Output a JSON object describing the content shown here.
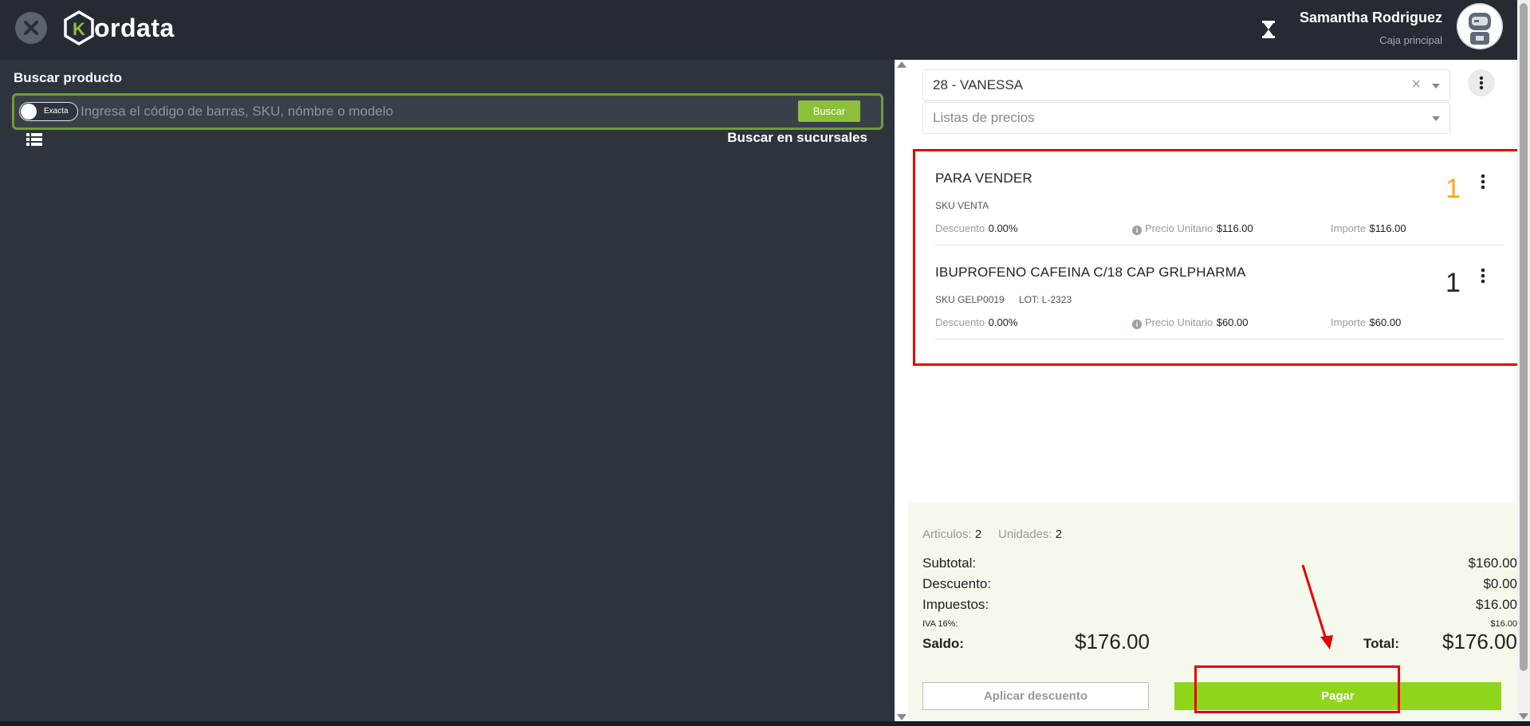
{
  "header": {
    "brand": "ordata",
    "brand_letter": "K",
    "user_name": "Samantha Rodriguez",
    "user_role": "Caja principal"
  },
  "search": {
    "title": "Buscar producto",
    "toggle_label": "Exacta",
    "placeholder": "Ingresa el código de barras, SKU, nómbre o modelo",
    "button_label": "Buscar",
    "branches_link": "Buscar en sucursales"
  },
  "customer": {
    "selected": "28 - VANESSA",
    "price_list_placeholder": "Listas de precios"
  },
  "cart": {
    "items": [
      {
        "name": "PARA VENDER",
        "sku": "SKU VENTA",
        "lot": "",
        "discount_label": "Descuento",
        "discount": "0.00%",
        "unit_price_label": "Precio Unitario",
        "unit_price": "$116.00",
        "amount_label": "Importe",
        "amount": "$116.00",
        "qty": "1",
        "qty_color": "#f5a623"
      },
      {
        "name": "IBUPROFENO CAFEINA C/18 CAP GRLPHARMA",
        "sku": "SKU GELP0019",
        "lot": "LOT: L-2323",
        "discount_label": "Descuento",
        "discount": "0.00%",
        "unit_price_label": "Precio Unitario",
        "unit_price": "$60.00",
        "amount_label": "Importe",
        "amount": "$60.00",
        "qty": "1",
        "qty_color": "#222222"
      }
    ]
  },
  "summary": {
    "articles_label": "Articulos:",
    "articles": "2",
    "units_label": "Unidades:",
    "units": "2",
    "subtotal_label": "Subtotal:",
    "subtotal": "$160.00",
    "discount_label": "Descuento:",
    "discount": "$0.00",
    "taxes_label": "Impuestos:",
    "taxes": "$16.00",
    "iva_label": "IVA 16%:",
    "iva": "$16.00",
    "balance_label": "Saldo:",
    "balance": "$176.00",
    "total_label": "Total:",
    "total": "$176.00"
  },
  "actions": {
    "apply_discount": "Aplicar descuento",
    "pay": "Pagar"
  },
  "colors": {
    "header_bg": "#252a33",
    "panel_bg": "#2e343e",
    "accent_green": "#8fd51a",
    "highlight_red": "#e60000"
  }
}
